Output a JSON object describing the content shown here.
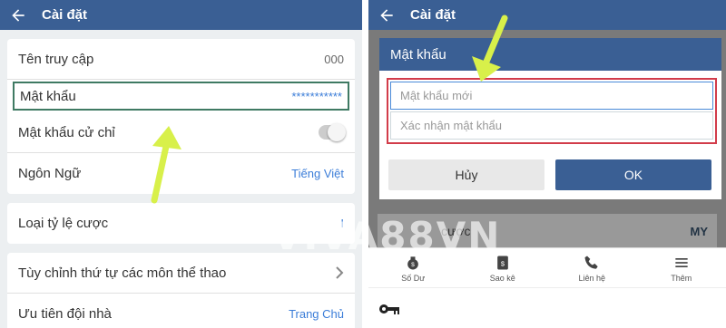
{
  "left": {
    "title": "Cài đặt",
    "rows": [
      {
        "label": "Tên truy cập",
        "value": "000"
      },
      {
        "label": "Mật khẩu",
        "value": "***********"
      },
      {
        "label": "Mật khẩu cử chỉ"
      },
      {
        "label": "Ngôn Ngữ",
        "value": "Tiếng Việt"
      }
    ],
    "odds_label": "Loại tỷ lệ cược",
    "sports_order_label": "Tùy chỉnh thứ tự các môn thể thao",
    "team_priority_label": "Ưu tiên đội nhà",
    "team_priority_value": "Trang Chủ"
  },
  "right": {
    "title": "Cài đặt",
    "dialog_title": "Mật khẩu",
    "new_password_placeholder": "Mật khẩu mới",
    "confirm_password_placeholder": "Xác nhận mật khẩu",
    "cancel_label": "Hủy",
    "ok_label": "OK",
    "bg_row_text": "cược",
    "bg_row_value": "MY",
    "tabs": [
      "Số Dư",
      "Sao kê",
      "Liên hệ",
      "Thêm"
    ]
  },
  "watermark": "VIVA88VN",
  "colors": {
    "primary": "#3a5f94",
    "link": "#3b7dd8",
    "highlight": "#d23c4a",
    "arrow": "#d8f04a"
  }
}
